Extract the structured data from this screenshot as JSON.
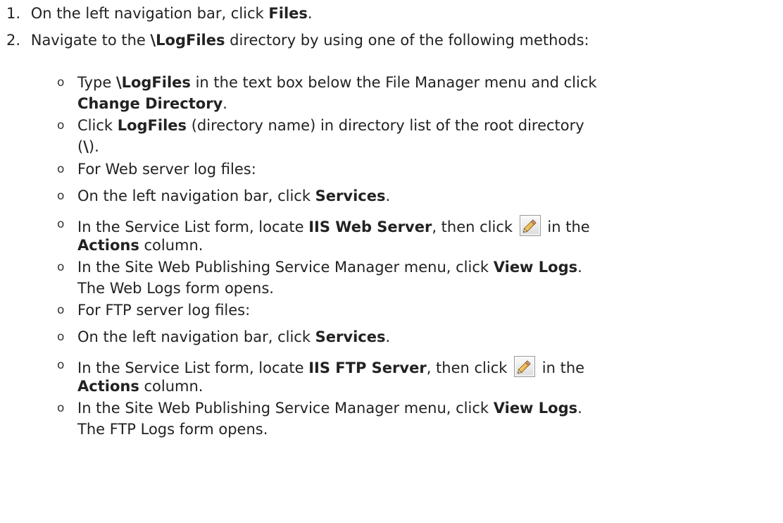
{
  "steps": [
    {
      "number": "1.",
      "segments": [
        {
          "text": "On the left navigation bar, click ",
          "bold": false
        },
        {
          "text": "Files",
          "bold": true
        },
        {
          "text": ".",
          "bold": false
        }
      ]
    },
    {
      "number": "2.",
      "segments": [
        {
          "text": "Navigate to the ",
          "bold": false
        },
        {
          "text": "\\LogFiles",
          "bold": true
        },
        {
          "text": " directory by using one of the following methods:",
          "bold": false
        }
      ]
    }
  ],
  "bullet_glyph": "o",
  "bullets": [
    {
      "lines": [
        [
          {
            "text": "Type ",
            "bold": false
          },
          {
            "text": "\\LogFiles",
            "bold": true
          },
          {
            "text": " in the text box below the File Manager menu and click",
            "bold": false
          }
        ],
        [
          {
            "text": "Change Directory",
            "bold": true
          },
          {
            "text": ".",
            "bold": false
          }
        ]
      ]
    },
    {
      "lines": [
        [
          {
            "text": "Click ",
            "bold": false
          },
          {
            "text": "LogFiles",
            "bold": true
          },
          {
            "text": " (directory name) in directory list of the root directory",
            "bold": false
          }
        ],
        [
          {
            "text": "(",
            "bold": false
          },
          {
            "text": "\\",
            "bold": true
          },
          {
            "text": ").",
            "bold": false
          }
        ]
      ]
    },
    {
      "lines": [
        [
          {
            "text": "For Web server log files:",
            "bold": false
          }
        ]
      ]
    },
    {
      "lines": [
        [
          {
            "text": "On the left navigation bar, click ",
            "bold": false
          },
          {
            "text": "Services",
            "bold": true
          },
          {
            "text": ".",
            "bold": false
          }
        ]
      ]
    },
    {
      "lines": [
        [
          {
            "text": "In the Service List form, locate ",
            "bold": false
          },
          {
            "text": "IIS Web Server",
            "bold": true
          },
          {
            "text": ", then click ",
            "bold": false
          },
          {
            "icon": "pencil-edit-icon"
          },
          {
            "text": " in the",
            "bold": false
          }
        ],
        [
          {
            "text": "Actions",
            "bold": true
          },
          {
            "text": " column.",
            "bold": false
          }
        ]
      ]
    },
    {
      "lines": [
        [
          {
            "text": "In the Site Web Publishing Service Manager menu, click ",
            "bold": false
          },
          {
            "text": "View Logs",
            "bold": true
          },
          {
            "text": ".",
            "bold": false
          }
        ],
        [
          {
            "text": "The Web Logs form opens.",
            "bold": false
          }
        ]
      ]
    },
    {
      "lines": [
        [
          {
            "text": "For FTP server log files:",
            "bold": false
          }
        ]
      ]
    },
    {
      "lines": [
        [
          {
            "text": "On the left navigation bar, click ",
            "bold": false
          },
          {
            "text": "Services",
            "bold": true
          },
          {
            "text": ".",
            "bold": false
          }
        ]
      ]
    },
    {
      "lines": [
        [
          {
            "text": "In the Service List form, locate ",
            "bold": false
          },
          {
            "text": "IIS FTP Server",
            "bold": true
          },
          {
            "text": ", then click ",
            "bold": false
          },
          {
            "icon": "pencil-edit-icon"
          },
          {
            "text": " in the",
            "bold": false
          }
        ],
        [
          {
            "text": "Actions",
            "bold": true
          },
          {
            "text": " column.",
            "bold": false
          }
        ]
      ]
    },
    {
      "lines": [
        [
          {
            "text": "In the Site Web Publishing Service Manager menu, click ",
            "bold": false
          },
          {
            "text": "View Logs",
            "bold": true
          },
          {
            "text": ".",
            "bold": false
          }
        ],
        [
          {
            "text": "The FTP Logs form opens.",
            "bold": false
          }
        ]
      ]
    }
  ]
}
